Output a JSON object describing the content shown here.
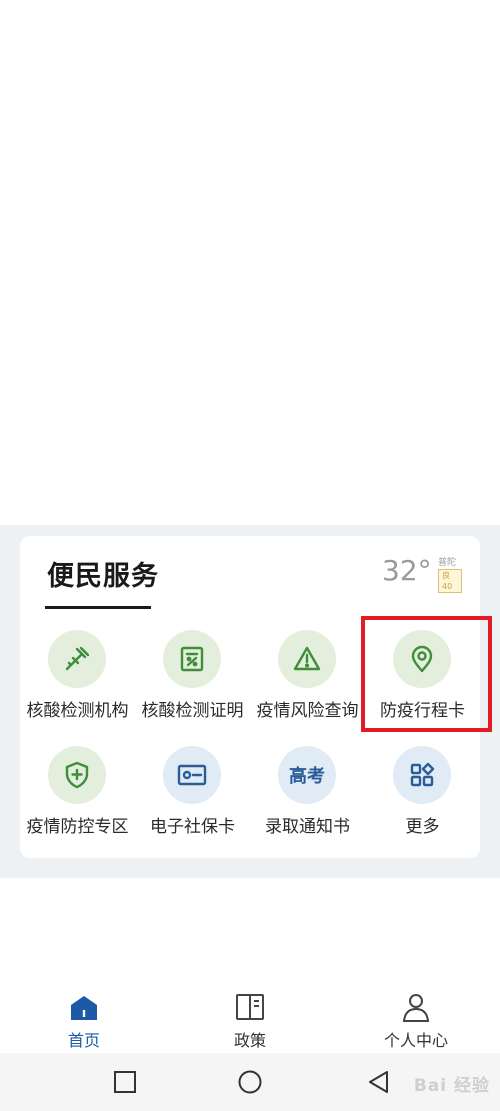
{
  "section": {
    "title": "便民服务",
    "weather": {
      "temperature": "32°",
      "district": "普陀区",
      "aqi": "良 40"
    }
  },
  "services": [
    {
      "label": "核酸检测机构",
      "icon": "dropper-icon"
    },
    {
      "label": "核酸检测证明",
      "icon": "certificate-icon"
    },
    {
      "label": "疫情风险查询",
      "icon": "warning-icon"
    },
    {
      "label": "防疫行程卡",
      "icon": "location-pin-icon"
    },
    {
      "label": "疫情防控专区",
      "icon": "shield-plus-icon"
    },
    {
      "label": "电子社保卡",
      "icon": "id-card-icon"
    },
    {
      "label": "录取通知书",
      "icon": "gaokao-icon",
      "icon_text": "高考"
    },
    {
      "label": "更多",
      "icon": "apps-grid-icon"
    }
  ],
  "nav": [
    {
      "label": "首页",
      "icon": "home-icon",
      "active": true
    },
    {
      "label": "政策",
      "icon": "book-icon",
      "active": false
    },
    {
      "label": "个人中心",
      "icon": "user-icon",
      "active": false
    }
  ],
  "watermark": "Bai 经验",
  "colors": {
    "accent_green": "#3e8e3a",
    "accent_blue": "#2a5d98",
    "highlight_red": "#e31b23",
    "nav_active": "#1d5aa6"
  }
}
